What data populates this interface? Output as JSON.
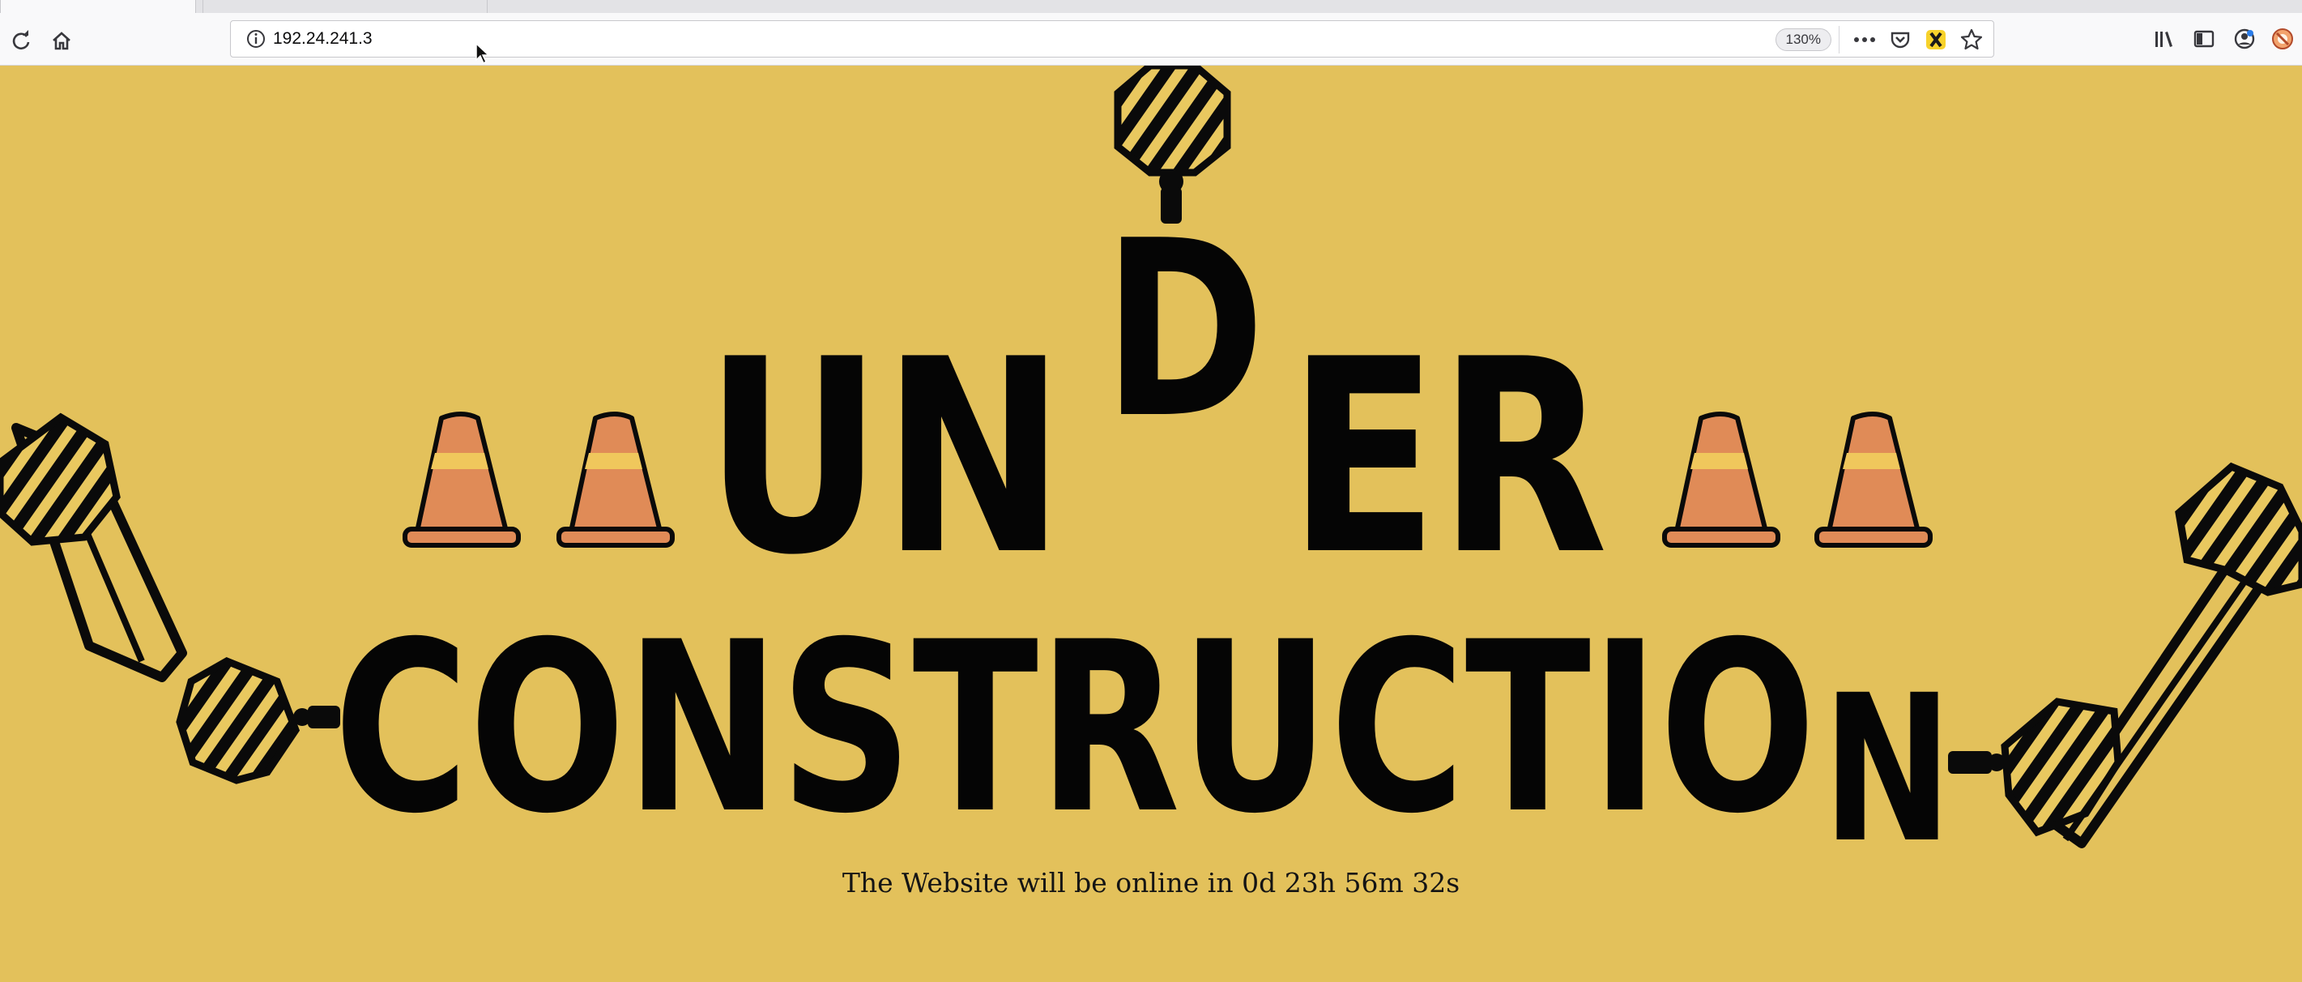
{
  "browser": {
    "url": "192.24.241.3",
    "zoom": "130%",
    "page_actions_glyph": "•••"
  },
  "page": {
    "heading_word1_part_a": "UN",
    "heading_word1_part_b": "D",
    "heading_word1_part_c": "ER",
    "heading_word2_main": "CONSTRUCTIO",
    "heading_word2_last": "N",
    "countdown": "The Website will be online in 0d 23h 56m 32s"
  },
  "colors": {
    "background": "#e3c15b",
    "letters": "#050505",
    "cone_orange": "#e08b57",
    "cone_stripe": "#f0c75c"
  },
  "icons": [
    "reload-icon",
    "home-icon",
    "info-icon",
    "page-actions-icon",
    "pocket-icon",
    "extension-icon",
    "bookmark-star-icon",
    "library-icon",
    "sidebar-icon",
    "account-icon",
    "addon-icon"
  ]
}
